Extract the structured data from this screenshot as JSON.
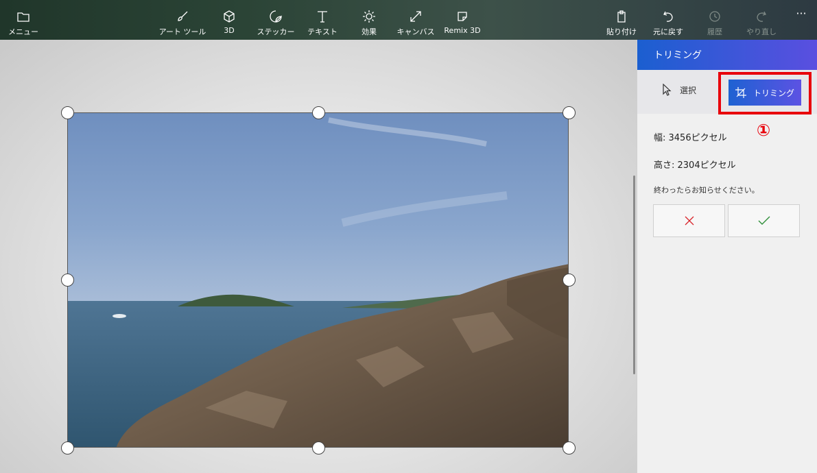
{
  "toolbar": {
    "menu": "メニュー",
    "art_tools": "アート ツール",
    "threed": "3D",
    "stickers": "ステッカー",
    "text": "テキスト",
    "effects": "効果",
    "canvas": "キャンバス",
    "remix": "Remix 3D",
    "paste": "貼り付け",
    "undo": "元に戻す",
    "history": "履歴",
    "redo": "やり直し",
    "more": "···"
  },
  "panel": {
    "title": "トリミング",
    "select_label": "選択",
    "crop_label": "トリミング",
    "width": "幅: 3456ピクセル",
    "height": "高さ: 2304ピクセル",
    "note": "終わったらお知らせください。",
    "annotation": "①"
  },
  "colors": {
    "accent_start": "#1b5fd0",
    "accent_end": "#5a4fe0",
    "annotation_red": "#e8000b"
  }
}
